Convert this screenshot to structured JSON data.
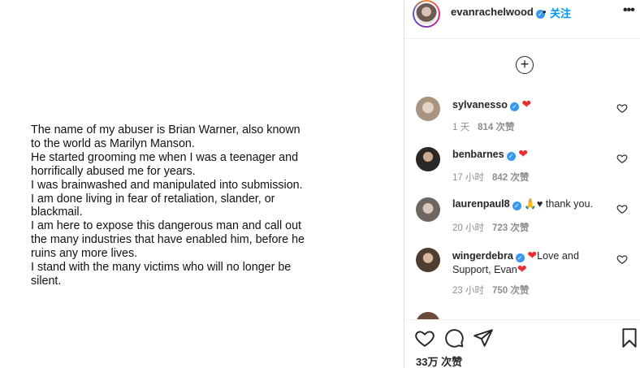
{
  "post": {
    "lines": [
      "The name of my abuser is Brian Warner, also known",
      "to the world as Marilyn Manson.",
      "He started grooming me when I was a teenager and",
      "horrifically abused me for years.",
      "I was brainwashed and manipulated into submission.",
      "I am done living in fear of retaliation, slander, or",
      "blackmail.",
      "I am here to expose this dangerous man and call out",
      "the many industries that have enabled him, before he",
      "ruins any more lives.",
      "I stand with the many victims who will no longer be",
      "silent."
    ]
  },
  "header": {
    "username": "evanrachelwood",
    "verified": "✓",
    "separator": "•",
    "follow_label": "关注",
    "more_label": "•••"
  },
  "load_more": "+",
  "comments": [
    {
      "username": "sylvanesso",
      "verified": "✓",
      "heart": "❤",
      "text": "",
      "time": "1 天",
      "likes": "814 次赞",
      "avatar_color": "#b8a79a"
    },
    {
      "username": "benbarnes",
      "verified": "✓",
      "heart": "❤",
      "text": "",
      "time": "17 小时",
      "likes": "842 次赞",
      "avatar_color": "#3f3a36"
    },
    {
      "username": "laurenpaul8",
      "verified": "✓",
      "heart": "",
      "text": "🙏♥ thank you.",
      "time": "20 小时",
      "likes": "723 次赞",
      "avatar_color": "#8a7f76"
    },
    {
      "username": "wingerdebra",
      "verified": "✓",
      "heart": "❤",
      "text": "Love and Support, Evan",
      "text_end_heart": "❤",
      "time": "23 小时",
      "likes": "750 次赞",
      "avatar_color": "#5b4a3e"
    }
  ],
  "actions": {
    "like_count": "33万 次赞"
  },
  "colors": {
    "accent": "#0095f6",
    "verified": "#3897f0",
    "heart": "#ed2d2d",
    "meta": "#8e8e8e"
  }
}
